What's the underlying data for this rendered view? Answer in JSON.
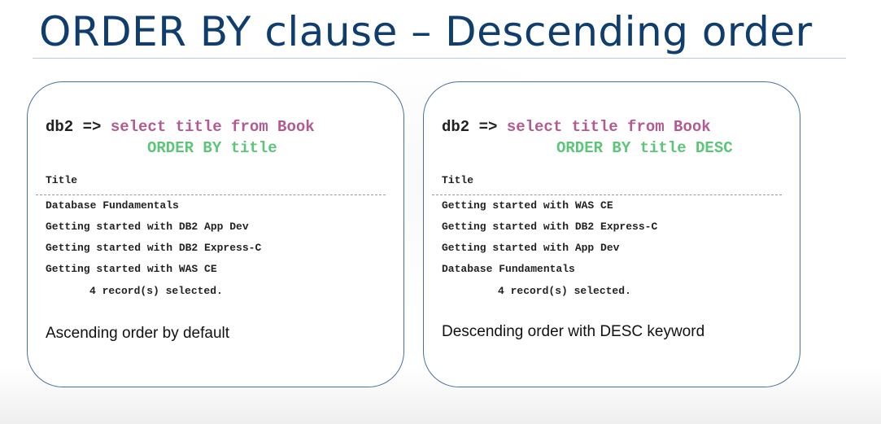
{
  "slide": {
    "title": "ORDER BY clause – Descending order"
  },
  "panels": [
    {
      "prompt": "db2 =>",
      "command": "select title from Book",
      "clause": "ORDER BY title",
      "column_header": "Title",
      "rows": [
        "Database Fundamentals",
        "Getting started with DB2 App Dev",
        "Getting started with DB2 Express-C",
        "Getting started with WAS CE"
      ],
      "summary": "4 record(s) selected.",
      "note": "Ascending order by default"
    },
    {
      "prompt": "db2 =>",
      "command": "select title from Book",
      "clause": "ORDER BY title DESC",
      "column_header": "Title",
      "rows": [
        "Getting started with WAS CE",
        "Getting started with DB2 Express-C",
        "Getting started with App Dev",
        "Database Fundamentals"
      ],
      "summary": "4 record(s) selected.",
      "note": "Descending order with DESC keyword"
    }
  ],
  "colors": {
    "title": "#0f3d6e",
    "sql_keyword": "#b15b92",
    "order_clause": "#5cc57a",
    "panel_border": "#4b6fa0"
  }
}
